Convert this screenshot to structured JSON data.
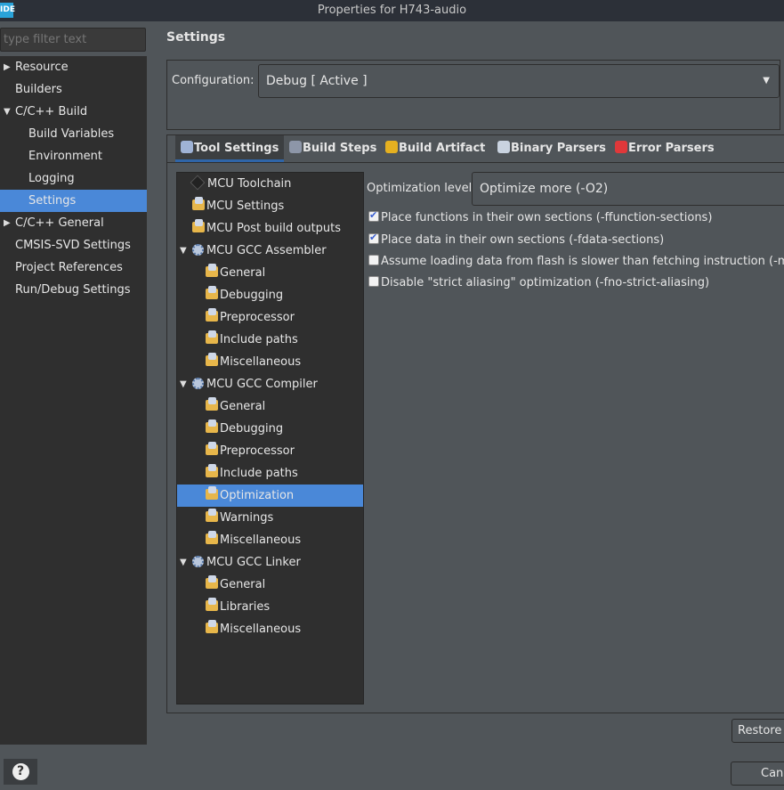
{
  "window": {
    "app_badge": "IDE",
    "title": "Properties for H743-audio"
  },
  "filter": {
    "placeholder": "type filter text"
  },
  "nav": [
    {
      "label": "Resource",
      "indent": 0,
      "toggle": "collapsed"
    },
    {
      "label": "Builders",
      "indent": 0,
      "toggle": ""
    },
    {
      "label": "C/C++ Build",
      "indent": 0,
      "toggle": "expanded"
    },
    {
      "label": "Build Variables",
      "indent": 1,
      "toggle": ""
    },
    {
      "label": "Environment",
      "indent": 1,
      "toggle": ""
    },
    {
      "label": "Logging",
      "indent": 1,
      "toggle": ""
    },
    {
      "label": "Settings",
      "indent": 1,
      "toggle": "",
      "selected": true
    },
    {
      "label": "C/C++ General",
      "indent": 0,
      "toggle": "collapsed"
    },
    {
      "label": "CMSIS-SVD Settings",
      "indent": 0,
      "toggle": ""
    },
    {
      "label": "Project References",
      "indent": 0,
      "toggle": ""
    },
    {
      "label": "Run/Debug Settings",
      "indent": 0,
      "toggle": ""
    }
  ],
  "page_title": "Settings",
  "configuration": {
    "label": "Configuration:",
    "value": "Debug  [ Active ]"
  },
  "tabs": [
    {
      "label": "Tool Settings",
      "icon": "tool-settings-icon",
      "color": "#9fb3d6",
      "active": true
    },
    {
      "label": "Build Steps",
      "icon": "build-steps-icon",
      "color": "#8d96a8"
    },
    {
      "label": "Build Artifact",
      "icon": "trophy-icon",
      "color": "#e5b020"
    },
    {
      "label": "Binary Parsers",
      "icon": "binary-file-icon",
      "color": "#c9d3e0"
    },
    {
      "label": "Error Parsers",
      "icon": "error-icon",
      "color": "#e0383a"
    }
  ],
  "tool_tree": [
    {
      "label": "MCU Toolchain",
      "level": 0,
      "icon": "chip"
    },
    {
      "label": "MCU Settings",
      "level": 0,
      "icon": "folder"
    },
    {
      "label": "MCU Post build outputs",
      "level": 0,
      "icon": "folder"
    },
    {
      "label": "MCU GCC Assembler",
      "level": 0,
      "icon": "gear",
      "expanded": true
    },
    {
      "label": "General",
      "level": 1,
      "icon": "folder"
    },
    {
      "label": "Debugging",
      "level": 1,
      "icon": "folder"
    },
    {
      "label": "Preprocessor",
      "level": 1,
      "icon": "folder"
    },
    {
      "label": "Include paths",
      "level": 1,
      "icon": "folder"
    },
    {
      "label": "Miscellaneous",
      "level": 1,
      "icon": "folder"
    },
    {
      "label": "MCU GCC Compiler",
      "level": 0,
      "icon": "gear",
      "expanded": true
    },
    {
      "label": "General",
      "level": 1,
      "icon": "folder"
    },
    {
      "label": "Debugging",
      "level": 1,
      "icon": "folder"
    },
    {
      "label": "Preprocessor",
      "level": 1,
      "icon": "folder"
    },
    {
      "label": "Include paths",
      "level": 1,
      "icon": "folder"
    },
    {
      "label": "Optimization",
      "level": 1,
      "icon": "folder",
      "selected": true
    },
    {
      "label": "Warnings",
      "level": 1,
      "icon": "folder"
    },
    {
      "label": "Miscellaneous",
      "level": 1,
      "icon": "folder"
    },
    {
      "label": "MCU GCC Linker",
      "level": 0,
      "icon": "gear",
      "expanded": true
    },
    {
      "label": "General",
      "level": 1,
      "icon": "folder"
    },
    {
      "label": "Libraries",
      "level": 1,
      "icon": "folder"
    },
    {
      "label": "Miscellaneous",
      "level": 1,
      "icon": "folder"
    }
  ],
  "optimization": {
    "label": "Optimization level",
    "value": "Optimize more (-O2)"
  },
  "options": [
    {
      "label": "Place functions in their own sections (-ffunction-sections)",
      "checked": true
    },
    {
      "label": "Place data in their own sections (-fdata-sections)",
      "checked": true
    },
    {
      "label": "Assume loading data from flash is slower than fetching instruction (-mslow",
      "checked": false
    },
    {
      "label": "Disable \"strict aliasing\" optimization (-fno-strict-aliasing)",
      "checked": false
    }
  ],
  "buttons": {
    "restore": "Restore",
    "cancel": "Cancel",
    "help": "?"
  }
}
